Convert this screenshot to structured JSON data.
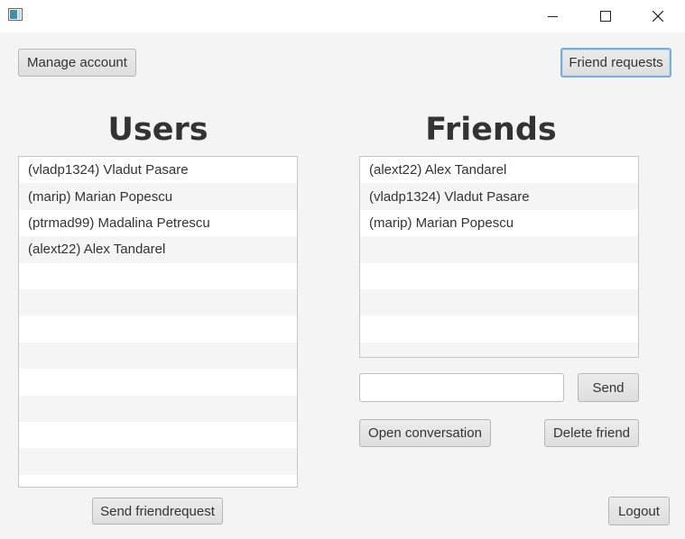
{
  "window": {
    "controls": [
      "minimize-icon",
      "maximize-icon",
      "close-icon"
    ]
  },
  "toolbar": {
    "manage_account_label": "Manage account",
    "friend_requests_label": "Friend requests"
  },
  "users": {
    "title": "Users",
    "items": [
      "(vladp1324) Vladut Pasare",
      "(marip) Marian Popescu",
      "(ptrmad99) Madalina Petrescu",
      "(alext22) Alex Tandarel"
    ],
    "send_request_label": "Send friendrequest"
  },
  "friends": {
    "title": "Friends",
    "items": [
      "(alext22) Alex Tandarel",
      "(vladp1324) Vladut Pasare",
      "(marip) Marian Popescu"
    ],
    "message_value": "",
    "send_label": "Send",
    "open_conversation_label": "Open conversation",
    "delete_friend_label": "Delete friend"
  },
  "footer": {
    "logout_label": "Logout"
  },
  "colors": {
    "background": "#f4f4f4",
    "focus_border": "#6fb0e6",
    "row_alt": "#f5f5f5"
  }
}
